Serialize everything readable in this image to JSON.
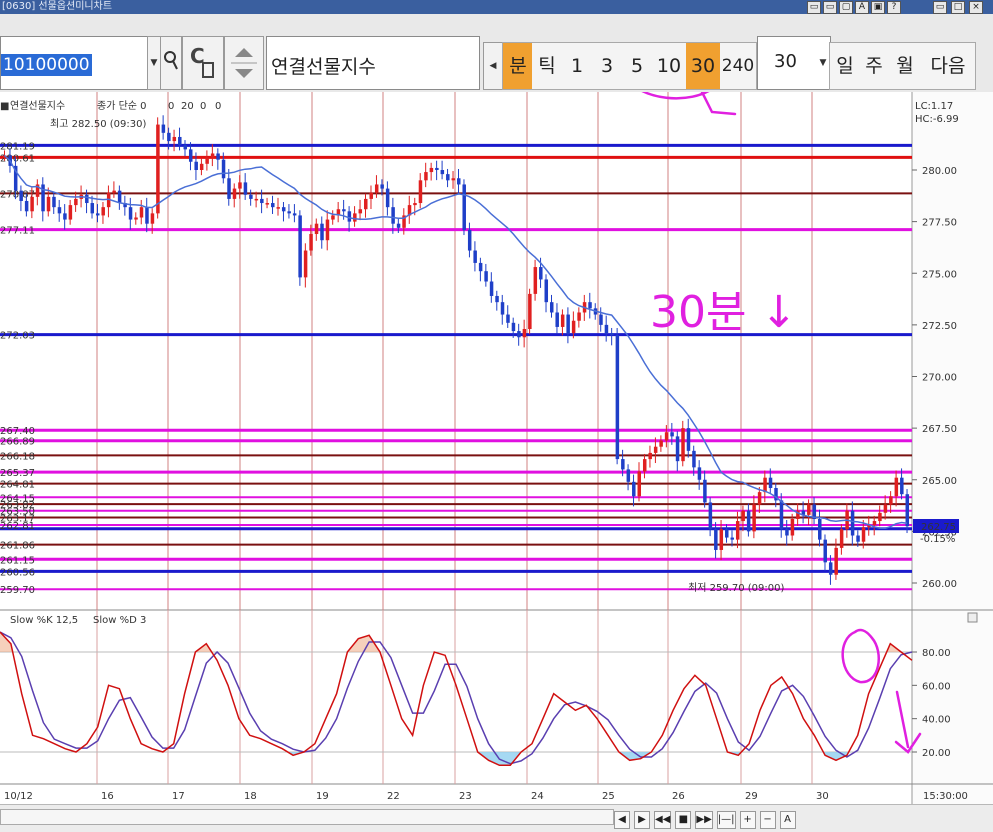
{
  "window": {
    "title": "[0630] 선물옵션미니차트",
    "buttons": [
      "▭",
      "▭",
      "▢",
      "A",
      "▣",
      "?",
      "▭",
      "□",
      "×"
    ]
  },
  "toolbar": {
    "code_value": "10100000",
    "name_value": "연결선물지수",
    "periods": [
      "분",
      "틱",
      "1",
      "3",
      "5",
      "10",
      "30",
      "240"
    ],
    "active_periods": [
      "분",
      "30"
    ],
    "interval_value": "30",
    "view_buttons": [
      "일",
      "주",
      "월",
      "다음"
    ]
  },
  "price_chart": {
    "header_name": "연결선물지수",
    "header_type": "종가 단순 0",
    "header_params": [
      "0",
      "20",
      "0",
      "0"
    ],
    "lc_label": "LC:1.17",
    "hc_label": "HC:-6.99",
    "high_note": "최고 282.50 (09:30)",
    "low_note": "최저 259.70 (09:00)",
    "current_price": "262.75",
    "change_pct": "-0.15%",
    "y_ticks": [
      "280.00",
      "277.50",
      "275.00",
      "272.50",
      "270.00",
      "267.50",
      "265.00",
      "262.50",
      "260.00"
    ],
    "left_levels": [
      "281.19",
      "280.61",
      "278.87",
      "277.11",
      "272.03",
      "267.40",
      "266.89",
      "266.18",
      "265.37",
      "264.81",
      "264.15",
      "263.82",
      "263.50",
      "263.17",
      "262.81",
      "261.86",
      "261.15",
      "260.56",
      "259.70"
    ],
    "x_labels": [
      "10/12",
      "16",
      "17",
      "18",
      "19",
      "22",
      "23",
      "24",
      "25",
      "26",
      "29",
      "30"
    ],
    "time_label": "15:30:00"
  },
  "stochastic": {
    "title_k": "Slow %K 12,5",
    "title_d": "Slow %D 3",
    "y_ticks": [
      "80.00",
      "60.00",
      "40.00",
      "20.00"
    ]
  },
  "annotations": {
    "note_30min": "30분 ↓"
  },
  "bottombar": {
    "controls": [
      "◀",
      "▶",
      "◀◀",
      "■",
      "▶▶",
      "|—|",
      "+",
      "−",
      "A"
    ]
  },
  "colors": {
    "accent": "#f0a030",
    "rise_candle": "#e02020",
    "fall_candle": "#1f3fc8",
    "ma_line": "#4a6fd6",
    "level_blue": "#1a1acc",
    "level_red": "#e01010",
    "level_darkred": "#7a1010",
    "level_magenta": "#e010e0",
    "annotation": "#e020e0"
  }
}
